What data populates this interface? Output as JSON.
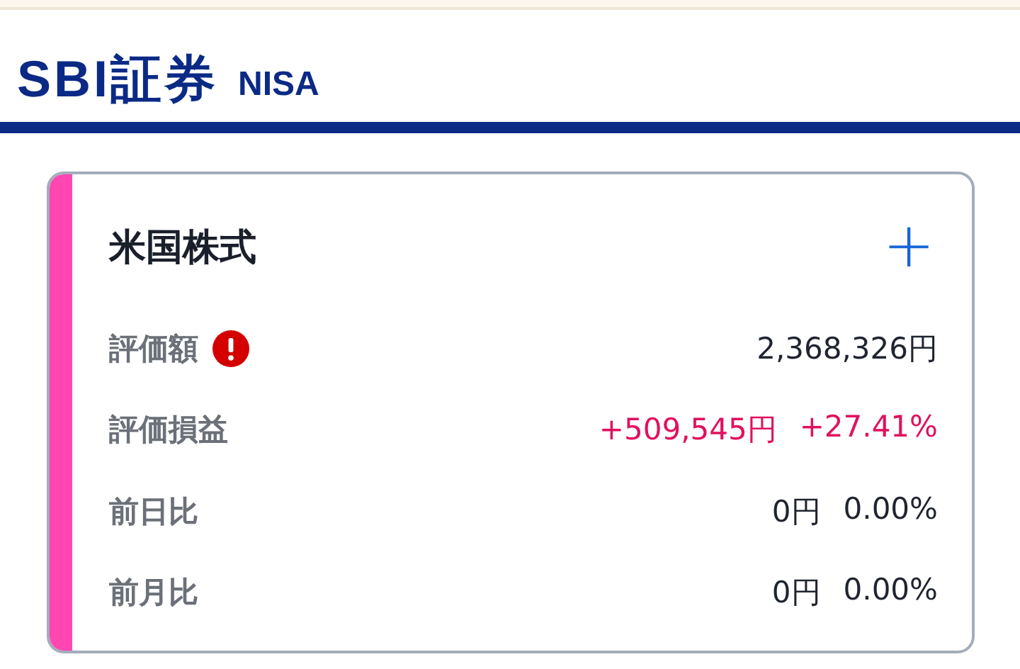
{
  "header": {
    "logo": "SBI証券",
    "badge": "NISA"
  },
  "card": {
    "title": "米国株式",
    "add_button": "+",
    "rows": [
      {
        "label": "評価額",
        "alert": true,
        "color": "#1f2430",
        "values": [
          "2,368,326円"
        ]
      },
      {
        "label": "評価損益",
        "alert": false,
        "color": "#e0115f",
        "values": [
          "+509,545円",
          "+27.41%"
        ]
      },
      {
        "label": "前日比",
        "alert": false,
        "color": "#1f2430",
        "values": [
          "0円",
          "0.00%"
        ]
      },
      {
        "label": "前月比",
        "alert": false,
        "color": "#1f2430",
        "values": [
          "0円",
          "0.00%"
        ]
      }
    ]
  }
}
